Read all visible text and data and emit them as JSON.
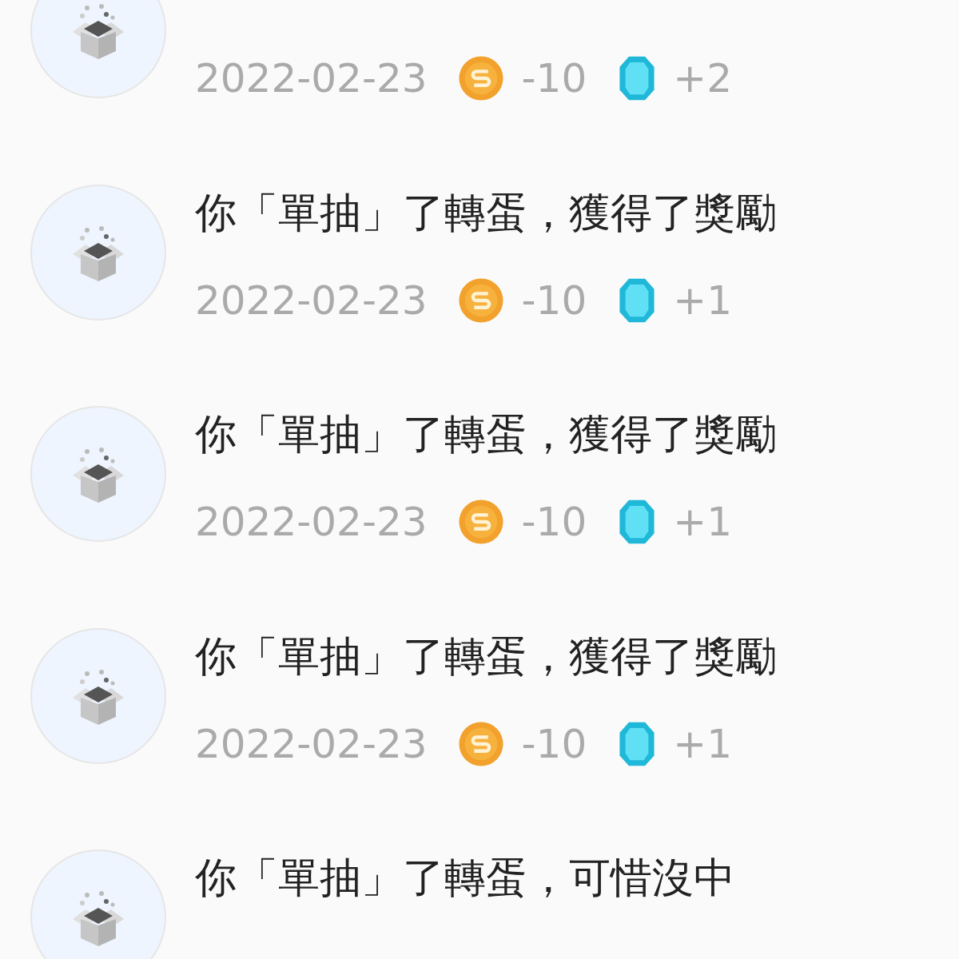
{
  "records": [
    {
      "date": "2022-02-23",
      "cost": "-10",
      "reward": "+2"
    },
    {
      "title": "你「單抽」了轉蛋，獲得了獎勵",
      "date": "2022-02-23",
      "cost": "-10",
      "reward": "+1"
    },
    {
      "title": "你「單抽」了轉蛋，獲得了獎勵",
      "date": "2022-02-23",
      "cost": "-10",
      "reward": "+1"
    },
    {
      "title": "你「單抽」了轉蛋，獲得了獎勵",
      "date": "2022-02-23",
      "cost": "-10",
      "reward": "+1"
    },
    {
      "title": "你「單抽」了轉蛋，可惜沒中"
    }
  ]
}
